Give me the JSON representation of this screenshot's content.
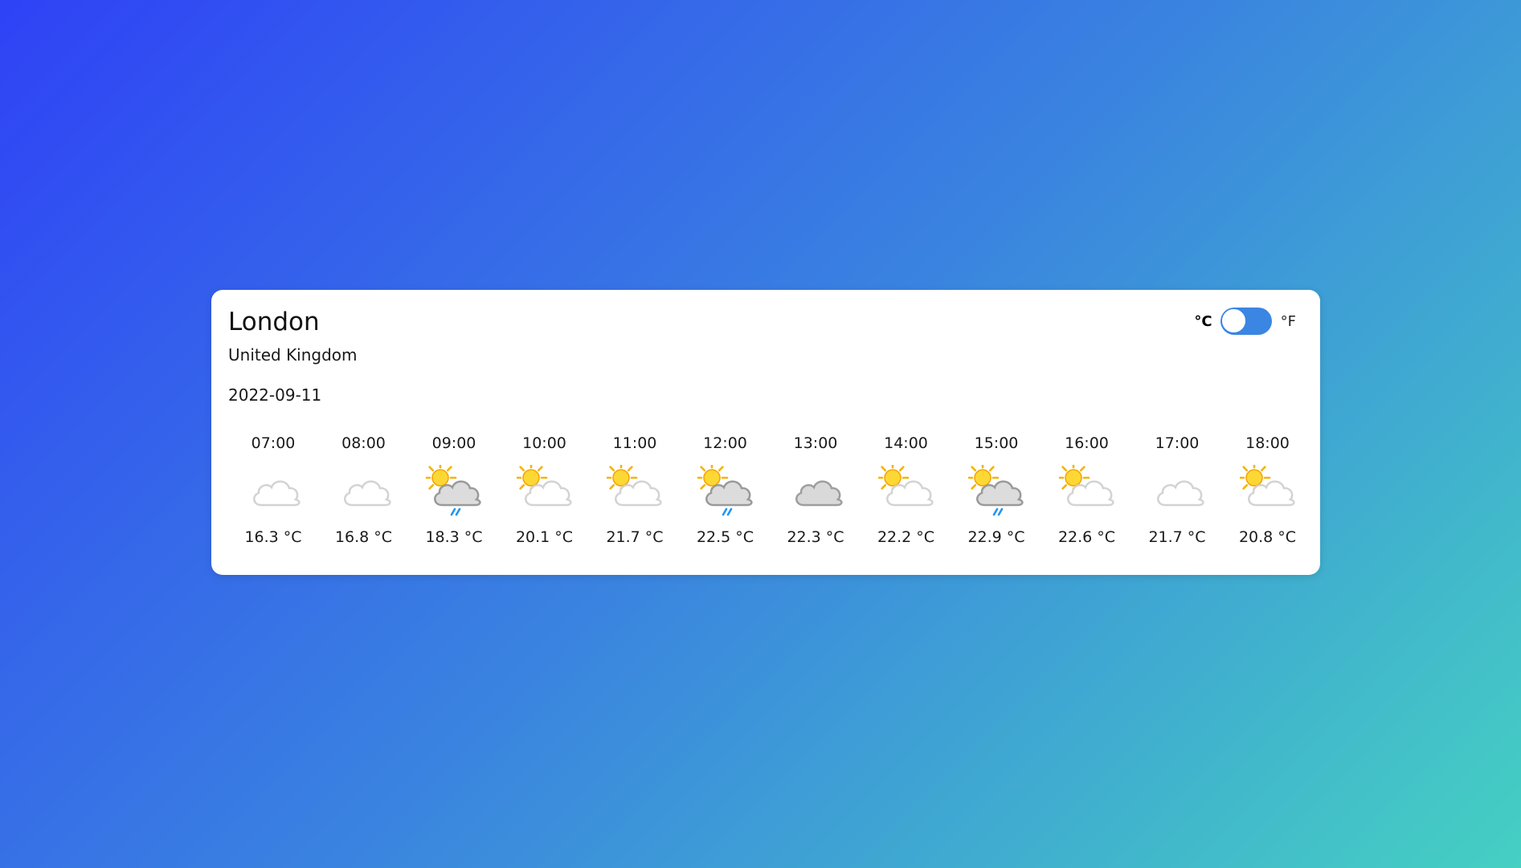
{
  "location": {
    "city": "London",
    "country": "United Kingdom",
    "date": "2022-09-11"
  },
  "unit_toggle": {
    "celsius_label": "°C",
    "fahrenheit_label": "°F",
    "selected": "°C",
    "accent_color": "#3a86e2"
  },
  "hourly": [
    {
      "time": "07:00",
      "icon": "cloud-icon",
      "temp": "16.3 °C"
    },
    {
      "time": "08:00",
      "icon": "cloud-icon",
      "temp": "16.8 °C"
    },
    {
      "time": "09:00",
      "icon": "sun-cloud-rain-icon",
      "temp": "18.3 °C"
    },
    {
      "time": "10:00",
      "icon": "partly-cloudy-icon",
      "temp": "20.1 °C"
    },
    {
      "time": "11:00",
      "icon": "partly-cloudy-icon",
      "temp": "21.7 °C"
    },
    {
      "time": "12:00",
      "icon": "sun-cloud-rain-icon",
      "temp": "22.5 °C"
    },
    {
      "time": "13:00",
      "icon": "overcast-cloud-icon",
      "temp": "22.3 °C"
    },
    {
      "time": "14:00",
      "icon": "partly-cloudy-icon",
      "temp": "22.2 °C"
    },
    {
      "time": "15:00",
      "icon": "sun-cloud-rain-icon",
      "temp": "22.9 °C"
    },
    {
      "time": "16:00",
      "icon": "partly-cloudy-icon",
      "temp": "22.6 °C"
    },
    {
      "time": "17:00",
      "icon": "cloud-icon",
      "temp": "21.7 °C"
    },
    {
      "time": "18:00",
      "icon": "partly-cloudy-icon",
      "temp": "20.8 °C"
    }
  ]
}
